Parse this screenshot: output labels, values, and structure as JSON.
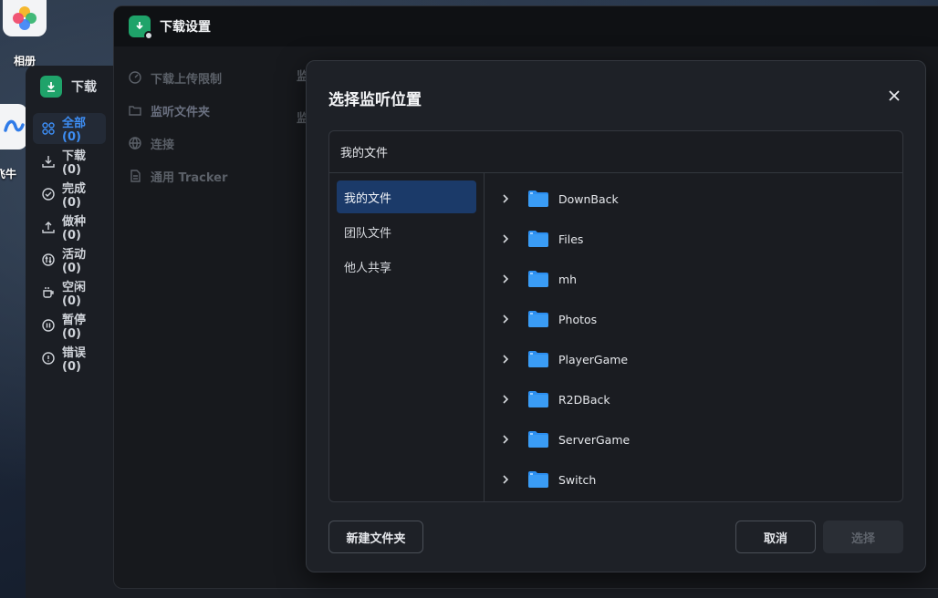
{
  "desktop": {
    "icons": [
      {
        "label": "相册"
      },
      {
        "label": "飞牛"
      }
    ]
  },
  "downloader": {
    "title": "下载",
    "nav": [
      {
        "label": "全部 (0)",
        "icon": "grid-icon",
        "active": true
      },
      {
        "label": "下载 (0)",
        "icon": "download-icon"
      },
      {
        "label": "完成 (0)",
        "icon": "check-circle-icon"
      },
      {
        "label": "做种 (0)",
        "icon": "upload-icon"
      },
      {
        "label": "活动 (0)",
        "icon": "activity-icon"
      },
      {
        "label": "空闲 (0)",
        "icon": "cup-icon"
      },
      {
        "label": "暂停 (0)",
        "icon": "pause-circle-icon"
      },
      {
        "label": "错误 (0)",
        "icon": "alert-circle-icon"
      }
    ]
  },
  "settings": {
    "title": "下载设置",
    "menu": [
      {
        "label": "下载上传限制",
        "icon": "speed-icon"
      },
      {
        "label": "监听文件夹",
        "icon": "folder-icon",
        "active": true
      },
      {
        "label": "连接",
        "icon": "globe-icon"
      },
      {
        "label": "通用 Tracker",
        "icon": "document-icon"
      }
    ],
    "fragments": [
      "监",
      "监"
    ]
  },
  "dialog": {
    "title": "选择监听位置",
    "path": "我的文件",
    "locations": [
      {
        "label": "我的文件",
        "active": true
      },
      {
        "label": "团队文件"
      },
      {
        "label": "他人共享"
      }
    ],
    "folders": [
      "DownBack",
      "Files",
      "mh",
      "Photos",
      "PlayerGame",
      "R2DBack",
      "ServerGame",
      "Switch"
    ],
    "buttons": {
      "new_folder": "新建文件夹",
      "cancel": "取消",
      "select": "选择"
    }
  },
  "colors": {
    "accent": "#3d8ef5",
    "selected_bg": "#1b3a69",
    "folder": "#2b8ef0",
    "app_green": "#1fa36a"
  }
}
